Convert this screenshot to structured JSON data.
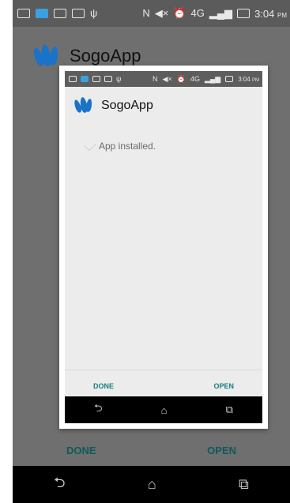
{
  "status_bar": {
    "time": "3:04",
    "ampm": "PM"
  },
  "app": {
    "name": "SogoApp"
  },
  "dialog": {
    "status_bar": {
      "time": "3:04",
      "ampm": "PM"
    },
    "app_name": "SogoApp",
    "message": "App installed.",
    "done_label": "DONE",
    "open_label": "OPEN"
  },
  "background_buttons": {
    "done_label": "DONE",
    "open_label": "OPEN"
  },
  "nav": {
    "back": "⮌",
    "home": "⌂",
    "recents": "⧉"
  },
  "colors": {
    "accent": "#1a7f7f",
    "logo": "#1a73c8"
  }
}
